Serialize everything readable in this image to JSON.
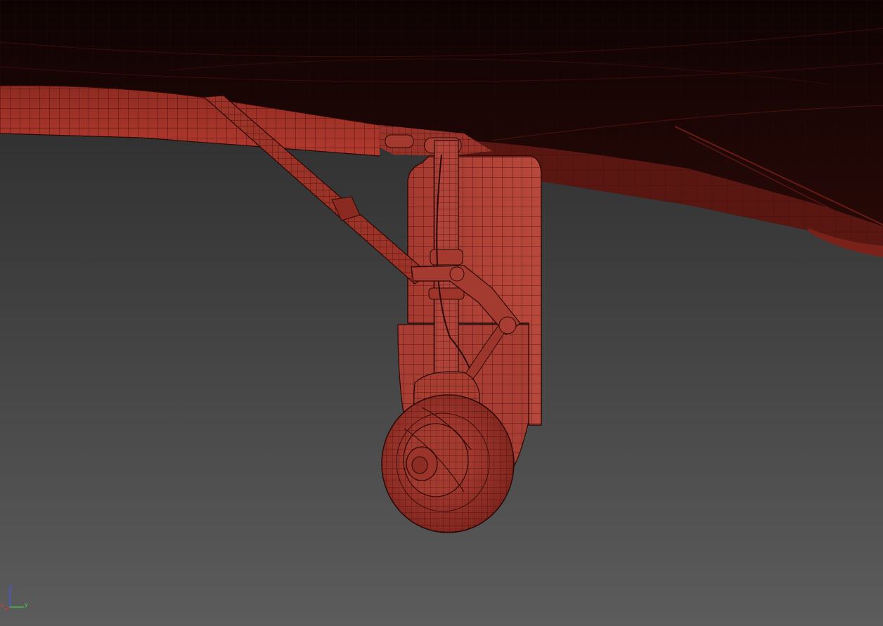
{
  "viewport": {
    "background_top": "#262626",
    "background_bottom": "#5c5c5c",
    "mesh_color": "#a8352c",
    "wire_color": "#3a0c08",
    "underside_color": "#140505"
  },
  "axis_gizmo": {
    "z_label": "z",
    "x_label": "x",
    "y_label": "y",
    "z_color": "#3a5cff",
    "x_color": "#e03a3a",
    "y_color": "#3ad43a"
  }
}
